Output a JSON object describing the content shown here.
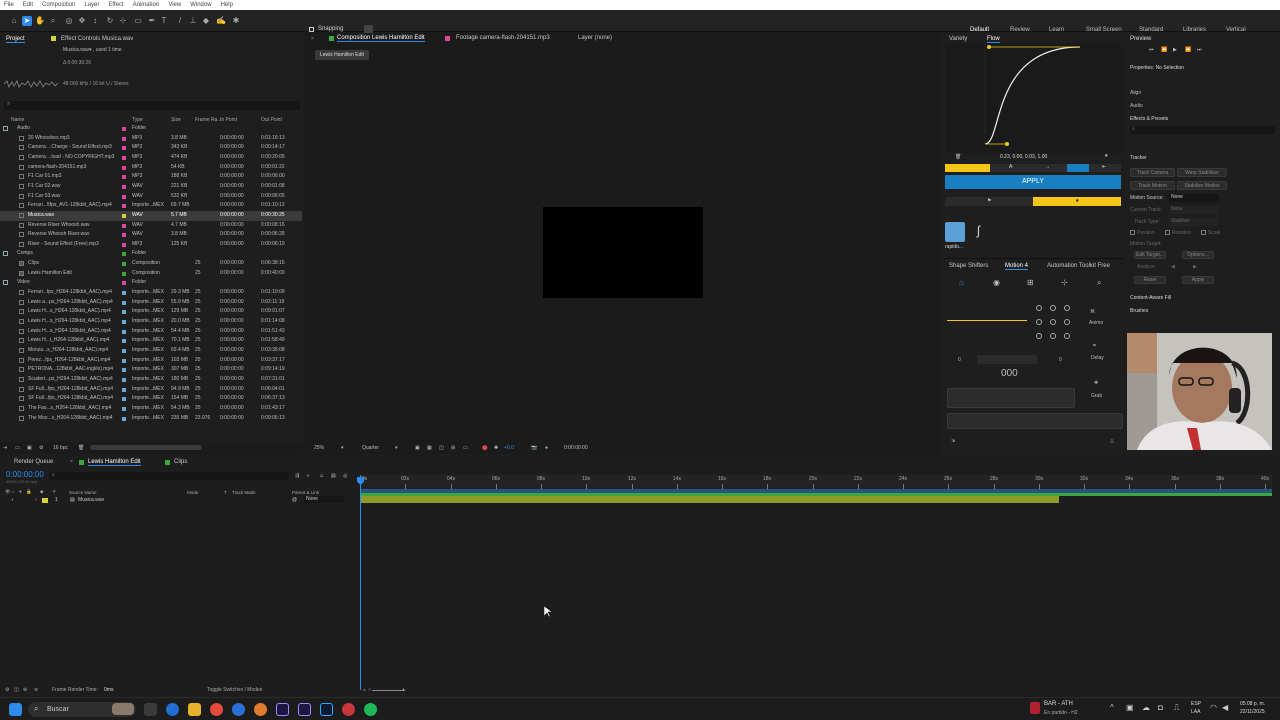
{
  "menu": [
    "File",
    "Edit",
    "Composition",
    "Layer",
    "Effect",
    "Animation",
    "View",
    "Window",
    "Help"
  ],
  "toolbar": {
    "snapping_label": "Snapping"
  },
  "workspaces": [
    "Default",
    "Review",
    "Learn",
    "Small Screen",
    "Standard",
    "Libraries",
    "Vertical"
  ],
  "project": {
    "tab_project": "Project",
    "tab_effect_controls": "Effect Controls Musica.wav",
    "info_name": "Musica.wav▾ , used 1 time",
    "info_duration": "Δ 0:00:30:26",
    "info_audio": "48.000 kHz / 16 bit U / Stereo",
    "search_placeholder": "",
    "columns": [
      "Name",
      "Type",
      "Size",
      "Frame Ra...",
      "In Point",
      "Out Point"
    ],
    "bpc": "16 bpc",
    "rows": [
      {
        "name": "Audio",
        "type": "Folder",
        "size": "",
        "fr": "",
        "in": "",
        "out": "",
        "color": "#e044a0",
        "kind": "folder",
        "indent": 0
      },
      {
        "name": "20 Whooshes.mp3",
        "type": "MP3",
        "size": "3.8 MB",
        "fr": "",
        "in": "0:00:00:00",
        "out": "0:01:16:13",
        "color": "#e044a0",
        "kind": "file",
        "indent": 1
      },
      {
        "name": "Camera ...Charge - Sound Effect.mp3",
        "type": "MP3",
        "size": "343 KB",
        "fr": "",
        "in": "0:00:00:00",
        "out": "0:00:14:17",
        "color": "#e044a0",
        "kind": "file",
        "indent": 1
      },
      {
        "name": "Camera ...load - NO COPYRIGHT.mp3",
        "type": "MP3",
        "size": "474 KB",
        "fr": "",
        "in": "0:00:00:00",
        "out": "0:00:20:05",
        "color": "#e044a0",
        "kind": "file",
        "indent": 1
      },
      {
        "name": "camera-flash-204151.mp3",
        "type": "MP3",
        "size": "54 KB",
        "fr": "",
        "in": "0:00:00:00",
        "out": "0:00:01:22",
        "color": "#e044a0",
        "kind": "file",
        "indent": 1
      },
      {
        "name": "F1 Car 01.mp3",
        "type": "MP3",
        "size": "188 KB",
        "fr": "",
        "in": "0:00:00:00",
        "out": "0:00:06:00",
        "color": "#e044a0",
        "kind": "file",
        "indent": 1
      },
      {
        "name": "F1 Car 02.wav",
        "type": "WAV",
        "size": "221 KB",
        "fr": "",
        "in": "0:00:00:00",
        "out": "0:00:01:08",
        "color": "#e044a0",
        "kind": "file",
        "indent": 1
      },
      {
        "name": "F1 Car 03.wav",
        "type": "WAV",
        "size": "532 KB",
        "fr": "",
        "in": "0:00:00:00",
        "out": "0:00:06:05",
        "color": "#e044a0",
        "kind": "file",
        "indent": 1
      },
      {
        "name": "Ferrari...5fps_AV1-128kbit_AAC).mp4",
        "type": "Importe...MEX",
        "size": "69.7 MB",
        "fr": "",
        "in": "0:00:00:00",
        "out": "0:01:10:12",
        "color": "#e044a0",
        "kind": "file",
        "indent": 1
      },
      {
        "name": "Musica.wav",
        "type": "WAV",
        "size": "5.7 MB",
        "fr": "",
        "in": "0:00:00:00",
        "out": "0:00:30:25",
        "color": "#d6d23c",
        "kind": "file",
        "indent": 1,
        "selected": true
      },
      {
        "name": "Reverse Riser Whoosh.wav",
        "type": "WAV",
        "size": "4.7 MB",
        "fr": "",
        "in": "0:00:00:00",
        "out": "0:00:08:16",
        "color": "#e044a0",
        "kind": "file",
        "indent": 1
      },
      {
        "name": "Reverse Whoosh Riser.wav",
        "type": "WAV",
        "size": "3.8 MB",
        "fr": "",
        "in": "0:00:00:00",
        "out": "0:00:06:28",
        "color": "#e044a0",
        "kind": "file",
        "indent": 1
      },
      {
        "name": "Riser - Sound Effect (Free).mp3",
        "type": "MP3",
        "size": "125 KB",
        "fr": "",
        "in": "0:00:00:00",
        "out": "0:00:06:19",
        "color": "#e044a0",
        "kind": "file",
        "indent": 1
      },
      {
        "name": "Comps",
        "type": "Folder",
        "size": "",
        "fr": "",
        "in": "",
        "out": "",
        "color": "#3aa83a",
        "kind": "folder",
        "indent": 0
      },
      {
        "name": "Clips",
        "type": "Composition",
        "size": "",
        "fr": "25",
        "in": "0:00:00:00",
        "out": "0:06:38:15",
        "color": "#3aa83a",
        "kind": "comp",
        "indent": 1
      },
      {
        "name": "Lewis Hamilton Edit",
        "type": "Composition",
        "size": "",
        "fr": "25",
        "in": "0:00:00:00",
        "out": "0:00:40:00",
        "color": "#3aa83a",
        "kind": "comp",
        "indent": 1
      },
      {
        "name": "Video",
        "type": "Folder",
        "size": "",
        "fr": "",
        "in": "",
        "out": "",
        "color": "#e044a0",
        "kind": "folder",
        "indent": 0
      },
      {
        "name": "Ferrari...fps_H264-128kbit_AAC).mp4",
        "type": "Importe...MEX",
        "size": "29.3 MB",
        "fr": "25",
        "in": "0:00:00:00",
        "out": "0:01:10:09",
        "color": "#6aa8d8",
        "kind": "file",
        "indent": 1
      },
      {
        "name": "Lewis a...ps_H264-128kbit_AAC).mp4",
        "type": "Importe...MEX",
        "size": "55.9 MB",
        "fr": "25",
        "in": "0:00:00:00",
        "out": "0:02:11:19",
        "color": "#6aa8d8",
        "kind": "file",
        "indent": 1
      },
      {
        "name": "Lewis H...s_H264-128kbit_AAC).mp4",
        "type": "Importe...MEX",
        "size": "129 MB",
        "fr": "25",
        "in": "0:00:00:00",
        "out": "0:09:01:07",
        "color": "#6aa8d8",
        "kind": "file",
        "indent": 1
      },
      {
        "name": "Lewis H...s_H264-128kbit_AAC).mp4",
        "type": "Importe...MEX",
        "size": "20.0 MB",
        "fr": "25",
        "in": "0:00:00:00",
        "out": "0:01:14:08",
        "color": "#6aa8d8",
        "kind": "file",
        "indent": 1
      },
      {
        "name": "Lewis H...s_H264-128kbit_AAC).mp4",
        "type": "Importe...MEX",
        "size": "54.4 MB",
        "fr": "25",
        "in": "0:00:00:00",
        "out": "0:01:51:43",
        "color": "#6aa8d8",
        "kind": "file",
        "indent": 1
      },
      {
        "name": "Lewis H...i_H264-128kbit_AAC).mp4",
        "type": "Importe...MEX",
        "size": "70.1 MB",
        "fr": "25",
        "in": "0:00:00:00",
        "out": "0:01:58:49",
        "color": "#6aa8d8",
        "kind": "file",
        "indent": 1
      },
      {
        "name": "Monza...s_H264-128kbit_AAC).mp4",
        "type": "Importe...MEX",
        "size": "69.4 MB",
        "fr": "25",
        "in": "0:00:00:00",
        "out": "0:03:35:08",
        "color": "#6aa8d8",
        "kind": "file",
        "indent": 1
      },
      {
        "name": "Perez...fps_H264-128kbit_AAC).mp4",
        "type": "Importe...MEX",
        "size": "103 MB",
        "fr": "25",
        "in": "0:00:00:00",
        "out": "0:03:37:17",
        "color": "#6aa8d8",
        "kind": "file",
        "indent": 1
      },
      {
        "name": "PETRONA...128kbit_AAC-inglés).mp4",
        "type": "Importe...MEX",
        "size": "307 MB",
        "fr": "25",
        "in": "0:00:00:00",
        "out": "0:09:14:19",
        "color": "#6aa8d8",
        "kind": "file",
        "indent": 1
      },
      {
        "name": "Scuderi...ps_H264-128kbit_AAC).mp4",
        "type": "Importe...MEX",
        "size": "180 MB",
        "fr": "25",
        "in": "0:00:00:00",
        "out": "0:07:31:01",
        "color": "#6aa8d8",
        "kind": "file",
        "indent": 1
      },
      {
        "name": "SF Full...fps_H264-128kbit_AAC).mp4",
        "type": "Importe...MEX",
        "size": "94.9 MB",
        "fr": "25",
        "in": "0:00:00:00",
        "out": "0:06:04:01",
        "color": "#6aa8d8",
        "kind": "file",
        "indent": 1
      },
      {
        "name": "SF Full...fps_H264-128kbit_AAC).mp4",
        "type": "Importe...MEX",
        "size": "154 MB",
        "fr": "25",
        "in": "0:00:00:00",
        "out": "0:06:37:13",
        "color": "#6aa8d8",
        "kind": "file",
        "indent": 1
      },
      {
        "name": "The Fas...s_H264-128kbit_AAC).mp4",
        "type": "Importe...MEX",
        "size": "54.3 MB",
        "fr": "25",
        "in": "0:00:00:00",
        "out": "0:01:43:17",
        "color": "#6aa8d8",
        "kind": "file",
        "indent": 1
      },
      {
        "name": "The Mos...s_H264-128kbit_AAC).mp4",
        "type": "Importe...MEX",
        "size": "235 MB",
        "fr": "23.976",
        "in": "0:00:00:00",
        "out": "0:09:06:13",
        "color": "#6aa8d8",
        "kind": "file",
        "indent": 1
      }
    ]
  },
  "viewer": {
    "tab_comp": "Composition Lewis Hamilton Edit",
    "tab_footage": "Footage camera-flash-204151.mp3",
    "tab_layer": "Layer (none)",
    "breadcrumb": "Lewis Hamilton Edit",
    "zoom": "25%",
    "resolution": "Quarter",
    "exposure": "+0.0",
    "timecode": "0:00:00:00"
  },
  "flow": {
    "tab_variety": "Variety",
    "tab_flow": "Flow",
    "values": "0.23, 0.00, 0.03, 1.00",
    "apply": "APPLY",
    "preset_name": "rapido...",
    "tab_shape": "Shape Shifters",
    "tab_motion": "Motion 4",
    "tab_automation": "Automation Toolkit Free",
    "animo": "Animo",
    "delay": "Delay",
    "grab": "Grab",
    "counter_left": "0",
    "counter_right": "0",
    "counter_display": "000"
  },
  "right": {
    "preview": "Preview",
    "properties": "Properties: No Selection",
    "align": "Align",
    "audio": "Audio",
    "effects": "Effects & Presets",
    "tracker": "Tracker",
    "track_camera": "Track Camera",
    "warp_stabilizer": "Warp Stabilizer",
    "track_motion": "Track Motion",
    "stabilize_motion": "Stabilize Motion",
    "motion_source": "Motion Source:",
    "motion_source_val": "None",
    "current_track": "Current Track:",
    "current_track_val": "None",
    "track_type": "Track Type:",
    "track_type_val": "Stabilize",
    "position": "Position",
    "rotation": "Rotation",
    "scale": "Scale",
    "motion_target": "Motion Target:",
    "edit_target": "Edit Target...",
    "options": "Options...",
    "analyze": "Analyze:",
    "reset": "Reset",
    "apply": "Apply",
    "content_aware": "Content-Aware Fill",
    "brushes": "Brushes"
  },
  "timeline": {
    "tab_render": "Render Queue",
    "tab_comp": "Lewis Hamilton Edit",
    "tab_clips": "Clips",
    "timecode": "0:00:00:00",
    "timecode_sub": "00000 (25.00 fps)",
    "col_source": "Source Name",
    "col_mode": "Mode",
    "col_t": "T",
    "col_trackmatte": "Track Matte",
    "col_parent": "Parent & Link",
    "layer_num": "1",
    "layer_name": "Musica.wav",
    "layer_parent": "None",
    "ruler": [
      "0s",
      "02s",
      "04s",
      "06s",
      "08s",
      "10s",
      "12s",
      "14s",
      "16s",
      "18s",
      "20s",
      "22s",
      "24s",
      "26s",
      "28s",
      "30s",
      "32s",
      "34s",
      "36s",
      "38s",
      "40s"
    ],
    "frame_render": "Frame Render Time:",
    "frame_render_val": "0ms",
    "toggle": "Toggle Switches / Modes"
  },
  "taskbar": {
    "search": "Buscar",
    "weather_title": "BAR - ATH",
    "weather_sub": "En partido - H2",
    "lang_top": "ESP",
    "lang_bottom": "LAA",
    "time": "05:08 p. m.",
    "date": "22/11/2025"
  },
  "colors": {
    "accent": "#2d8ceb",
    "flow_yellow": "#f5c518",
    "flow_blue": "#1a7fc1",
    "layer_bar": "#8f9c2c",
    "comp_green": "#3aa83a"
  }
}
